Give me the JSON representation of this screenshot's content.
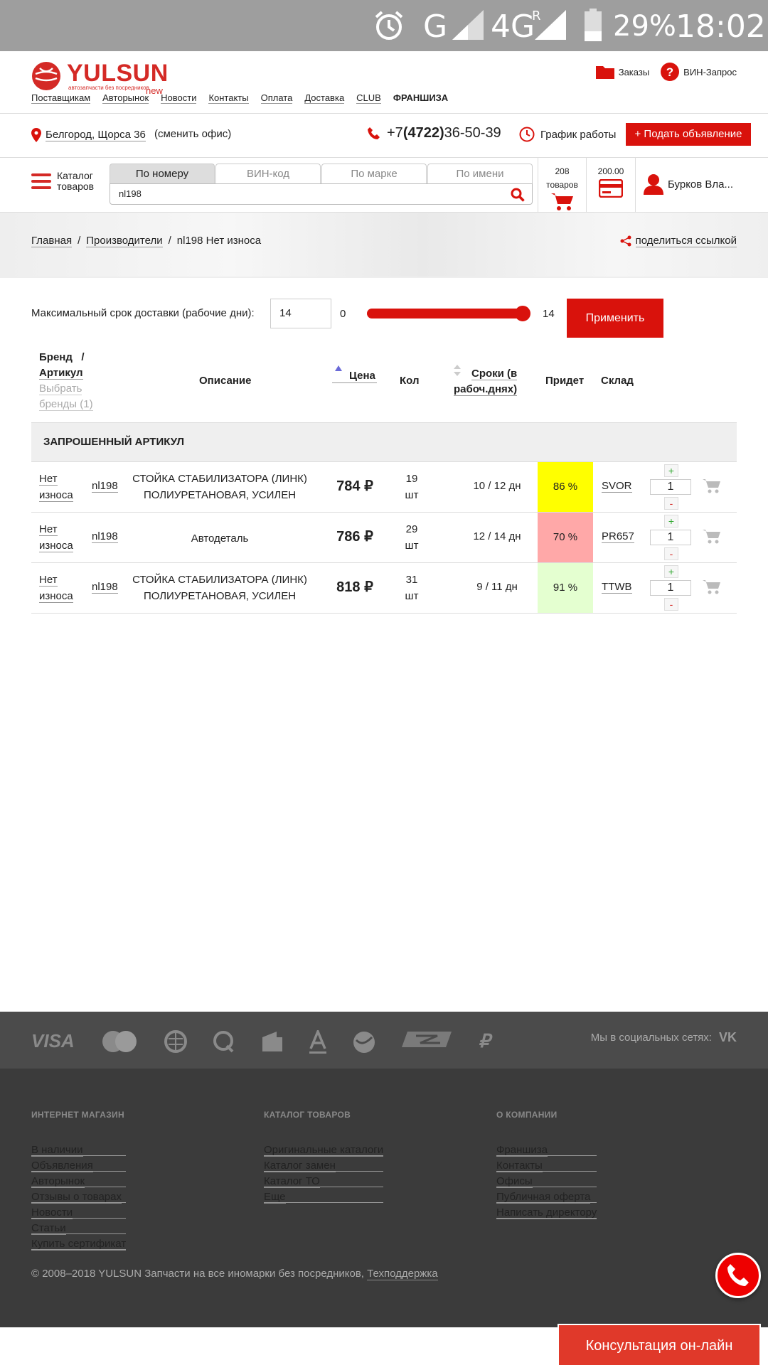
{
  "status_bar": {
    "network": "G",
    "network2": "4G",
    "roaming": "R",
    "battery": "29%",
    "time": "18:02"
  },
  "logo": {
    "name": "YULSUN",
    "tagline": "автозапчасти без посредников",
    "badge": "new"
  },
  "top_nav": [
    "Поставщикам",
    "Авторынок",
    "Новости",
    "Контакты",
    "Оплата",
    "Доставка",
    "CLUB",
    "ФРАНШИЗА"
  ],
  "header_links": {
    "orders": "Заказы",
    "vin_request": "ВИН-Запрос"
  },
  "info": {
    "location": "Белгород, Щорса 36",
    "change_office": "(сменить офис)",
    "phone_prefix": "+7",
    "phone_code": "(4722)",
    "phone_number": "36-50-39",
    "schedule": "График работы",
    "add_button": "+ Подать объявление"
  },
  "search": {
    "catalog_line1": "Каталог",
    "catalog_line2": "товаров",
    "tabs": [
      "По номеру",
      "ВИН-код",
      "По марке",
      "По имени"
    ],
    "value": "nl198",
    "cart_count": "208",
    "cart_label": "товаров",
    "balance": "200.00",
    "user": "Бурков Вла..."
  },
  "breadcrumb": {
    "home": "Главная",
    "sep": "/",
    "producers": "Производители",
    "current": "nl198 Нет износа",
    "share": "поделиться ссылкой"
  },
  "filter": {
    "label": "Максимальный срок доставки (рабочие дни):",
    "value": "14",
    "min": "0",
    "max": "14",
    "apply": "Применить"
  },
  "table": {
    "headers": {
      "brand": "Бренд",
      "slash": "/",
      "article": "Артикул",
      "choose_brands": "Выбрать",
      "choose_brands2": "бренды (1)",
      "description": "Описание",
      "price": "Цена",
      "qty": "Кол",
      "terms1": "Сроки (в",
      "terms2": "рабоч.днях)",
      "arrives": "Придет",
      "warehouse": "Склад"
    },
    "section": "ЗАПРОШЕННЫЙ АРТИКУЛ",
    "rows": [
      {
        "brand1": "Нет",
        "brand2": "износа",
        "article": "nl198",
        "desc1": "СТОЙКА СТАБИЛИЗАТОРА (ЛИНК)",
        "desc2": "ПОЛИУРЕТАНОВАЯ, УСИЛЕН",
        "price": "784 ₽",
        "qty1": "19",
        "qty2": "шт",
        "terms": "10 / 12 дн",
        "percent": "86 %",
        "percent_color": "#ffff00",
        "warehouse": "SVOR",
        "amount": "1",
        "plus": "+",
        "minus": "-"
      },
      {
        "brand1": "Нет",
        "brand2": "износа",
        "article": "nl198",
        "desc1": "Автодеталь",
        "desc2": "",
        "price": "786 ₽",
        "qty1": "29",
        "qty2": "шт",
        "terms": "12 / 14 дн",
        "percent": "70 %",
        "percent_color": "#ffa8a8",
        "warehouse": "PR657",
        "amount": "1",
        "plus": "+",
        "minus": "-"
      },
      {
        "brand1": "Нет",
        "brand2": "износа",
        "article": "nl198",
        "desc1": "СТОЙКА СТАБИЛИЗАТОРА (ЛИНК)",
        "desc2": "ПОЛИУРЕТАНОВАЯ, УСИЛЕН",
        "price": "818 ₽",
        "qty1": "31",
        "qty2": "шт",
        "terms": "9 / 11 дн",
        "percent": "91 %",
        "percent_color": "#e4ffd0",
        "warehouse": "TTWB",
        "amount": "1",
        "plus": "+",
        "minus": "-"
      }
    ]
  },
  "footer": {
    "payment_icons": [
      "visa-icon",
      "mastercard-icon",
      "webmoney-icon",
      "qiwi-icon",
      "yandex-money-icon",
      "alfa-bank-icon",
      "sberbank-icon",
      "contact-icon",
      "ruble-icon"
    ],
    "visa_text": "VISA",
    "ruble_text": "₽",
    "social_label": "Мы в социальных сетях:",
    "vk": "VK",
    "col1_title": "ИНТЕРНЕТ МАГАЗИН",
    "col1": [
      "В наличии",
      "Объявления",
      "Авторынок",
      "Отзывы о товарах",
      "Новости",
      "Статьи",
      "Купить сертификат"
    ],
    "col2_title": "КАТАЛОГ ТОВАРОВ",
    "col2": [
      "Оригинальные каталоги",
      "Каталог замен",
      "Каталог ТО",
      "Еще"
    ],
    "col3_title": "О КОМПАНИИ",
    "col3": [
      "Франшиза",
      "Контакты",
      "Офисы",
      "Публичная оферта",
      "Написать директору"
    ],
    "copyright": "© 2008–2018 YULSUN Запчасти на все иномарки без посредников,",
    "support": "Техподдержка",
    "consult": "Консультация он-лайн"
  },
  "colors": {
    "brand_red": "#d9120c",
    "footer_bg": "#3b3b3b",
    "status_bar": "#9e9e9e"
  }
}
